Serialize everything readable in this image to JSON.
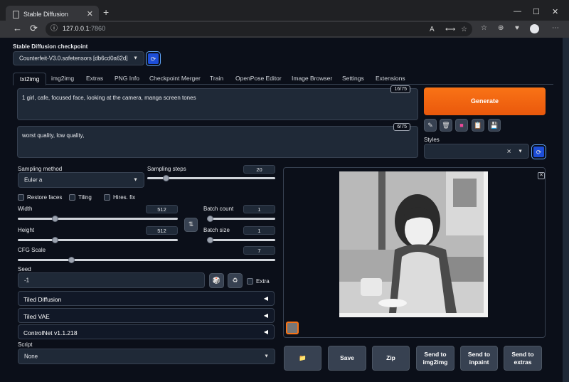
{
  "browser": {
    "tab_title": "Stable Diffusion",
    "tab_close": "✕",
    "new_tab": "+",
    "window_controls": {
      "minimize": "—",
      "maximize": "☐",
      "close": "✕"
    },
    "url_host": "127.0.0.1",
    "url_port": ":7860",
    "nav": {
      "back": "←",
      "refresh": "⟳",
      "info": "ⓘ"
    },
    "right_icons": [
      "A",
      "⟷",
      "☆",
      "☆",
      "⊕",
      "♥",
      "⋯"
    ]
  },
  "checkpoint": {
    "label": "Stable Diffusion checkpoint",
    "value": "Counterfeit-V3.0.safetensors [db6cd0a62d]",
    "refresh_icon": "⟳"
  },
  "tabs": [
    "txt2img",
    "img2img",
    "Extras",
    "PNG Info",
    "Checkpoint Merger",
    "Train",
    "OpenPose Editor",
    "Image Browser",
    "Settings",
    "Extensions"
  ],
  "prompt": {
    "text": "1 girl, cafe, focused face, looking at the camera, manga screen tones",
    "counter": "16/75"
  },
  "negative_prompt": {
    "text": "worst quality,  low quality,",
    "counter": "6/75"
  },
  "generate_label": "Generate",
  "tool_icons": [
    {
      "name": "pencil-icon",
      "glyph": "✎"
    },
    {
      "name": "trash-icon",
      "glyph": "🗑"
    },
    {
      "name": "style-icon",
      "glyph": "■"
    },
    {
      "name": "clipboard-icon",
      "glyph": "📋"
    },
    {
      "name": "save-style-icon",
      "glyph": "💾"
    }
  ],
  "styles": {
    "label": "Styles",
    "clear": "✕"
  },
  "sampling_method": {
    "label": "Sampling method",
    "value": "Euler a"
  },
  "sampling_steps": {
    "label": "Sampling steps",
    "value": "20",
    "fraction": 0.13
  },
  "checkboxes": {
    "restore_faces": "Restore faces",
    "tiling": "Tiling",
    "hires_fix": "Hires. fix"
  },
  "width": {
    "label": "Width",
    "value": "512",
    "fraction": 0.22
  },
  "height": {
    "label": "Height",
    "value": "512",
    "fraction": 0.22
  },
  "swap_icon": "⇅",
  "batch_count": {
    "label": "Batch count",
    "value": "1",
    "fraction": 0.0
  },
  "batch_size": {
    "label": "Batch size",
    "value": "1",
    "fraction": 0.0
  },
  "cfg_scale": {
    "label": "CFG Scale",
    "value": "7",
    "fraction": 0.2
  },
  "seed": {
    "label": "Seed",
    "value": "-1",
    "dice_icon": "🎲",
    "recycle_icon": "♻",
    "extra_label": "Extra"
  },
  "accordions": [
    {
      "label": "Tiled Diffusion",
      "arrow": "◀"
    },
    {
      "label": "Tiled VAE",
      "arrow": "◀"
    },
    {
      "label": "ControlNet v1.1.218",
      "arrow": "◀"
    }
  ],
  "script": {
    "label": "Script",
    "value": "None"
  },
  "gallery": {
    "close": "✕"
  },
  "buttons": {
    "folder": "📁",
    "save": "Save",
    "zip": "Zip",
    "send_img2img_1": "Send to",
    "send_img2img_2": "img2img",
    "send_inpaint_1": "Send to",
    "send_inpaint_2": "inpaint",
    "send_extras_1": "Send to",
    "send_extras_2": "extras"
  }
}
